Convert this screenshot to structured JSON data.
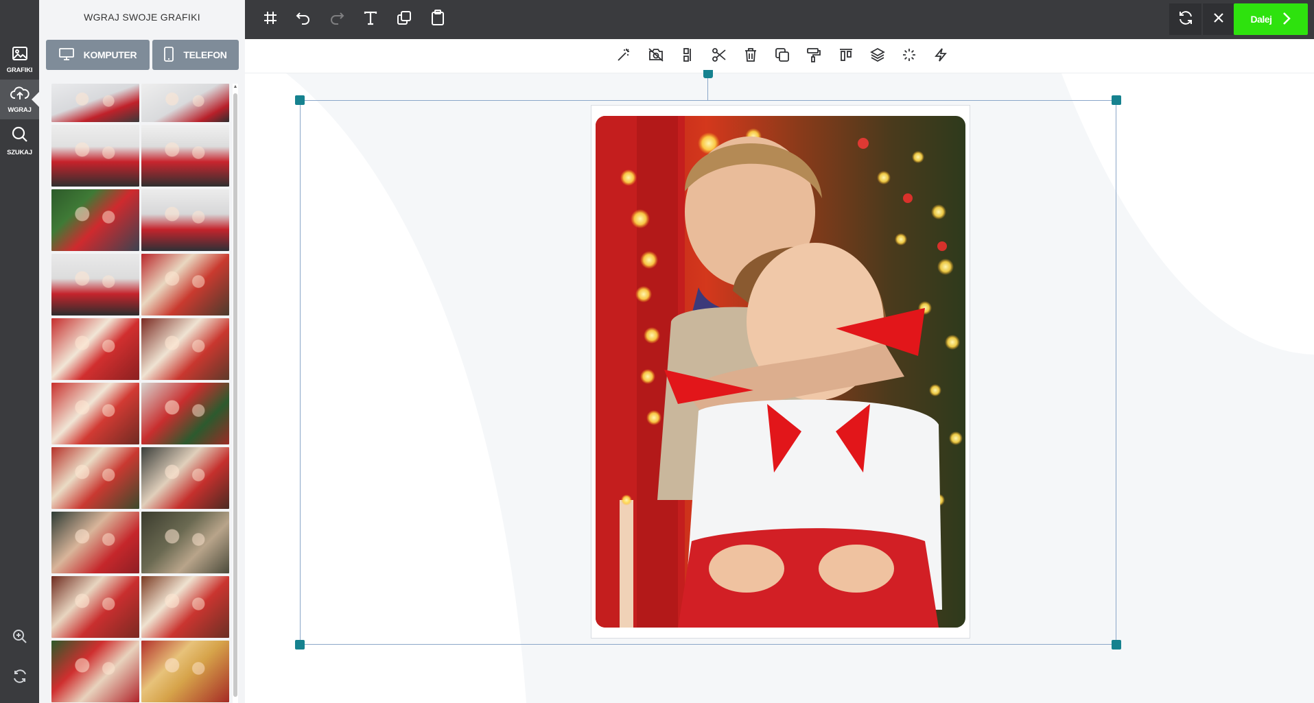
{
  "sidebar": {
    "items": [
      {
        "label": "GRAFIKI",
        "icon": "image-icon"
      },
      {
        "label": "WGRAJ",
        "icon": "upload-cloud-icon"
      },
      {
        "label": "SZUKAJ",
        "icon": "search-icon"
      }
    ],
    "bottom": [
      {
        "icon": "zoom-in-icon"
      },
      {
        "icon": "refresh-icon"
      }
    ]
  },
  "panel": {
    "title": "WGRAJ SWOJE GRAFIKI",
    "buttons": [
      {
        "label": "KOMPUTER",
        "icon": "monitor-icon"
      },
      {
        "label": "TELEFON",
        "icon": "phone-icon"
      }
    ],
    "thumbnail_count": 20
  },
  "topbar": {
    "tools": [
      "grid-icon",
      "undo-icon",
      "redo-icon",
      "text-icon",
      "duplicate-icon",
      "clipboard-icon"
    ],
    "right": {
      "reload_icon": "sync-icon",
      "close_icon": "close-icon",
      "next_label": "Dalej",
      "next_icon": "chevron-right-icon"
    }
  },
  "toolbar2": {
    "tools": [
      "magic-wand-icon",
      "no-camera-icon",
      "align-vertical-icon",
      "scissors-icon",
      "trash-icon",
      "copy-icon",
      "paint-roller-icon",
      "align-top-icon",
      "layers-icon",
      "loader-icon",
      "lightning-icon"
    ]
  },
  "colors": {
    "dark": "#3a3b3e",
    "panel_bg": "#f3f4f6",
    "source_button": "#7f8c99",
    "accent_green": "#2ee20e",
    "handle": "#16828f",
    "selection_border": "#8aa6c8"
  }
}
